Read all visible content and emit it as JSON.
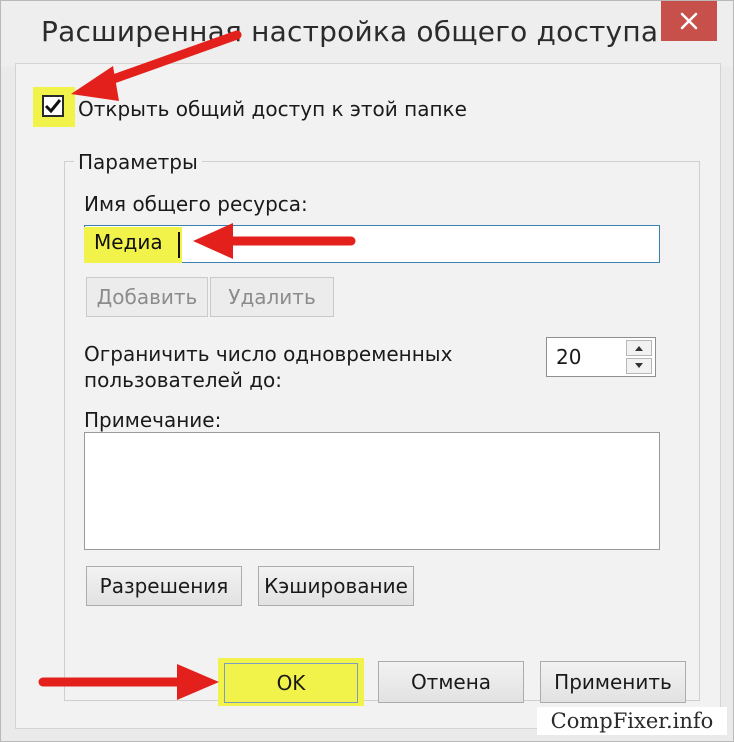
{
  "window": {
    "title": "Расширенная настройка общего доступа",
    "close_icon": "close-icon"
  },
  "share": {
    "checked": true,
    "label": "Открыть общий доступ к этой папке"
  },
  "params": {
    "legend": "Параметры",
    "share_name_label": "Имя общего ресурса:",
    "share_name_value": "Медиа",
    "add_button": "Добавить",
    "remove_button": "Удалить",
    "limit_label_line1": "Ограничить число одновременных",
    "limit_label_line2": "пользователей до:",
    "limit_value": "20",
    "comment_label": "Примечание:",
    "comment_value": "",
    "permissions_button": "Разрешения",
    "caching_button": "Кэширование"
  },
  "footer": {
    "ok_button": "OK",
    "cancel_button": "Отмена",
    "apply_button": "Применить"
  },
  "watermark": "CompFixer.info",
  "colors": {
    "highlight": "#f1f24a",
    "arrow": "#e3201b",
    "close": "#c7514a"
  }
}
